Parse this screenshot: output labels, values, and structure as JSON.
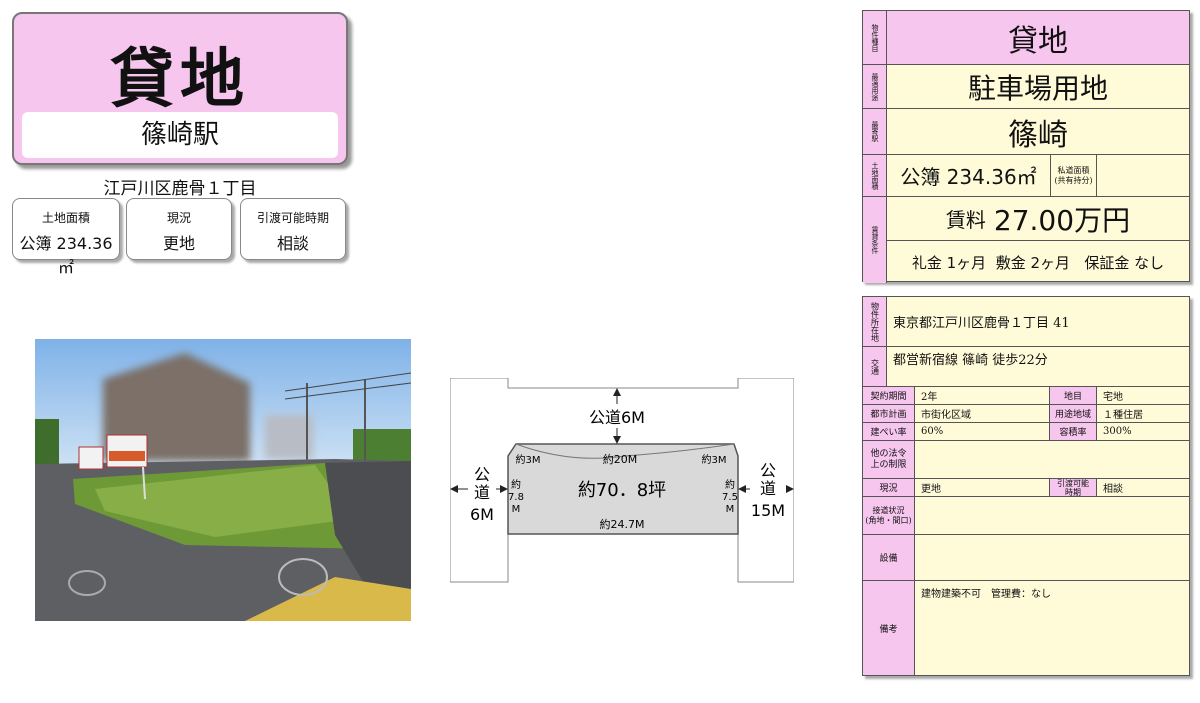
{
  "title_card": {
    "type": "貸地",
    "station": "篠崎駅"
  },
  "address_short": "江戸川区鹿骨１丁目",
  "info_boxes": [
    {
      "label": "土地面積",
      "value": "公簿 234.36㎡"
    },
    {
      "label": "現況",
      "value": "更地"
    },
    {
      "label": "引渡可能時期",
      "value": "相談"
    }
  ],
  "plan": {
    "road_top": "公道6M",
    "road_left": [
      "公",
      "道",
      "6M"
    ],
    "road_right": [
      "公",
      "道",
      "15M"
    ],
    "area": "約70．8坪",
    "top_width": "約20M",
    "bottom_width": "約24.7M",
    "corner_left": "約3M",
    "corner_right": "約3M",
    "left_depth": [
      "約",
      "7.8",
      "M"
    ],
    "right_depth": [
      "約",
      "7.5",
      "M"
    ]
  },
  "summary": {
    "type_hd": "物件種目",
    "type": "貸地",
    "use_hd": "最適用途",
    "use": "駐車場用地",
    "station_hd": "最寄駅",
    "station": "篠崎",
    "land_hd": "土地面積",
    "land": "公簿 234.36㎡",
    "private_road": "私道面積",
    "private_road_sub": "(共有持分)",
    "terms_hd": "賃貸条件",
    "rent_label": "賃料",
    "rent": "27.00万円",
    "fees": "礼金 1ヶ月  敷金 2ヶ月   保証金 なし"
  },
  "details": {
    "location_hd": "物件所在地",
    "location": "東京都江戸川区鹿骨１丁目 41",
    "traffic_hd": "交通",
    "traffic": "都営新宿線 篠崎 徒歩22分",
    "contract_period_hd": "契約期間",
    "contract_period": "2年",
    "land_category_hd": "地目",
    "land_category": "宅地",
    "city_plan_hd": "都市計画",
    "city_plan": "市街化区域",
    "zoning_hd": "用途地域",
    "zoning": "１種住居",
    "bcr_hd": "建ぺい率",
    "bcr": "60%",
    "far_hd": "容積率",
    "far": "300%",
    "other_law_hd": "他の法令上の制限",
    "other_law": "",
    "status_hd": "現況",
    "status": "更地",
    "handover_hd": "引渡可能時期",
    "handover": "相談",
    "road_access_hd": "接道状況",
    "road_access_sub": "(角地・間口)",
    "road_access": "",
    "facilities_hd": "設備",
    "facilities": "",
    "remarks_hd": "備考",
    "remarks": "建物建築不可　管理費：なし"
  },
  "colors": {
    "pink": "#f6c6ee",
    "cream": "#fffbd9"
  }
}
